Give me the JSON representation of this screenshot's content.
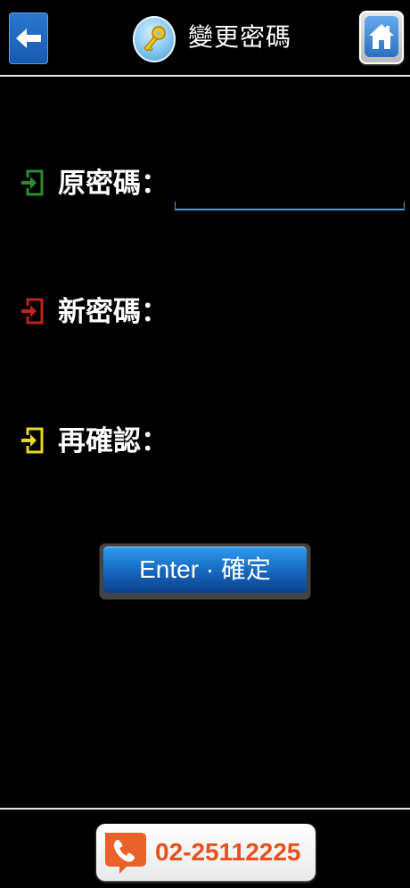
{
  "header": {
    "title": "變更密碼",
    "back_icon": "arrow-left-icon",
    "key_icon": "key-icon",
    "home_icon": "home-icon"
  },
  "form": {
    "rows": [
      {
        "label": "原密碼：",
        "value": "",
        "icon": "enter-arrow-icon",
        "icon_color": "#2e8b2e"
      },
      {
        "label": "新密碼：",
        "value": "",
        "icon": "enter-arrow-icon",
        "icon_color": "#c0231a"
      },
      {
        "label": "再確認：",
        "value": "",
        "icon": "enter-arrow-icon",
        "icon_color": "#e6d81c"
      }
    ]
  },
  "submit": {
    "label": "Enter · 確定"
  },
  "footer": {
    "phone": "02-25112225",
    "phone_icon": "phone-icon"
  },
  "colors": {
    "background": "#000000",
    "accent_blue": "#1a6fc7",
    "phone_orange": "#e8501e"
  }
}
